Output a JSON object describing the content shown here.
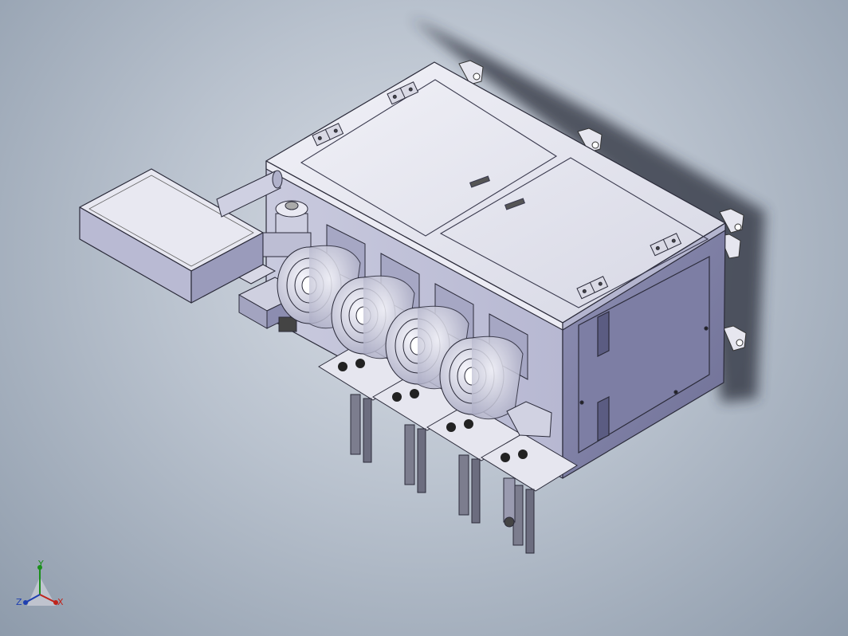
{
  "viewport": {
    "background_top": "#d9dee6",
    "background_bottom": "#8e9bab",
    "model_body_color": "#dcdde8",
    "model_side_color": "#a7a8c6",
    "model_dark_color": "#4a4a66"
  },
  "model": {
    "modules": [
      "module-1",
      "module-2",
      "module-3",
      "module-4"
    ]
  },
  "triad": {
    "y_label": "Y",
    "x_label": "X",
    "z_label": "Z",
    "y_color": "#1a8f1a",
    "x_color": "#c0231b",
    "z_color": "#1f3fb0"
  }
}
